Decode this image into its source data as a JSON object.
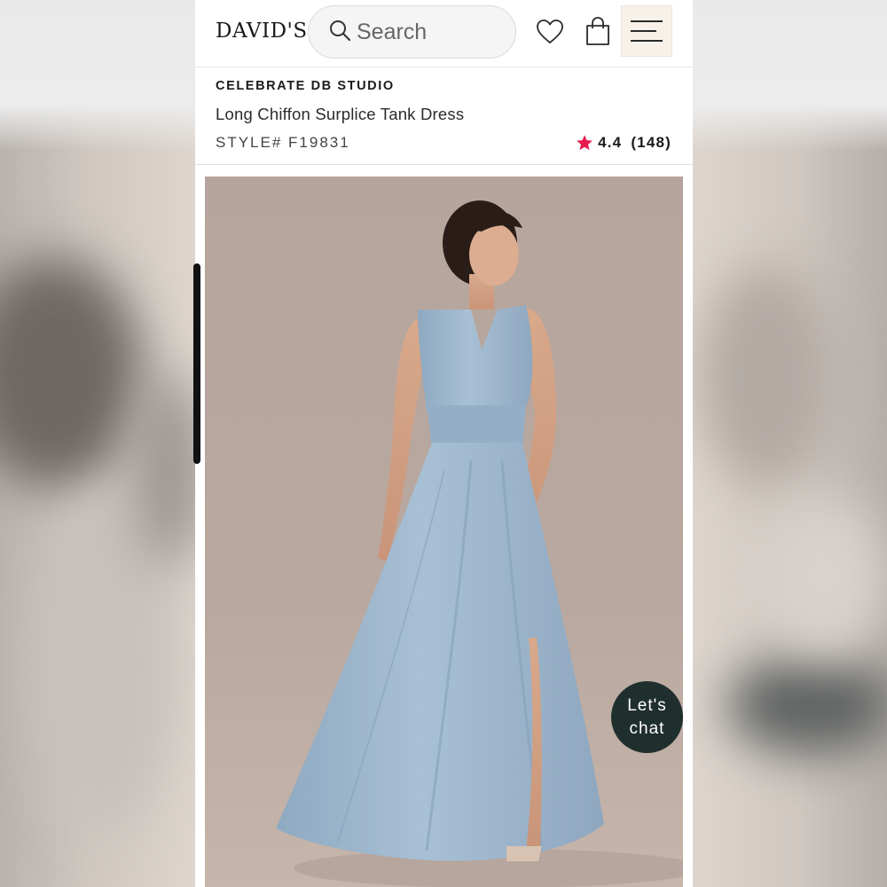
{
  "header": {
    "logo": "DAVID'S",
    "search_placeholder": "Search",
    "icons": [
      "search-icon",
      "heart-icon",
      "shopping-bag-icon",
      "menu-icon"
    ]
  },
  "product": {
    "brand": "CELEBRATE DB STUDIO",
    "title": "Long Chiffon Surplice Tank Dress",
    "style": "STYLE# F19831",
    "rating": "4.4",
    "reviews": "(148)"
  },
  "chat": {
    "line1": "Let's",
    "line2": "chat"
  },
  "colors": {
    "rating_star": "#e8194f",
    "chat_button": "#1f2f2d",
    "dress": "#9fb8cf",
    "photo_bg": "#b7a69c"
  }
}
